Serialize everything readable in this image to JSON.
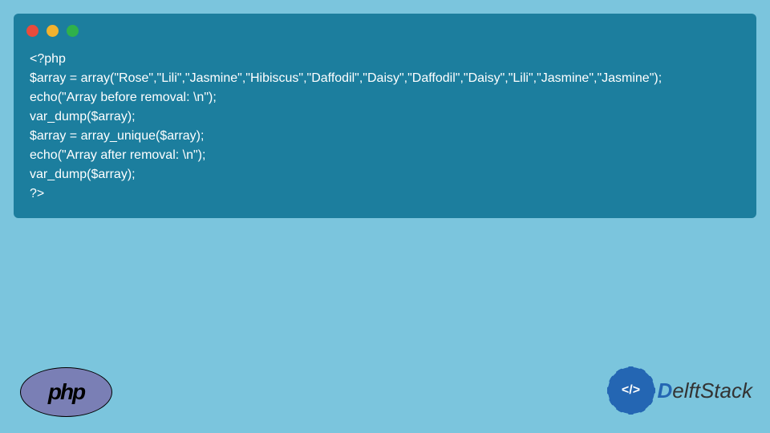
{
  "code": {
    "line1": "<?php",
    "line2": "$array = array(\"Rose\",\"Lili\",\"Jasmine\",\"Hibiscus\",\"Daffodil\",\"Daisy\",\"Daffodil\",\"Daisy\",\"Lili\",\"Jasmine\",\"Jasmine\");",
    "line3": "echo(\"Array before removal: \\n\");",
    "line4": "var_dump($array);",
    "line5": "$array = array_unique($array);",
    "line6": "echo(\"Array after removal: \\n\");",
    "line7": "var_dump($array);",
    "line8": "?>"
  },
  "logos": {
    "php": "php",
    "delft_code": "</>",
    "delft_prefix": "D",
    "delft_rest": "elftStack"
  }
}
